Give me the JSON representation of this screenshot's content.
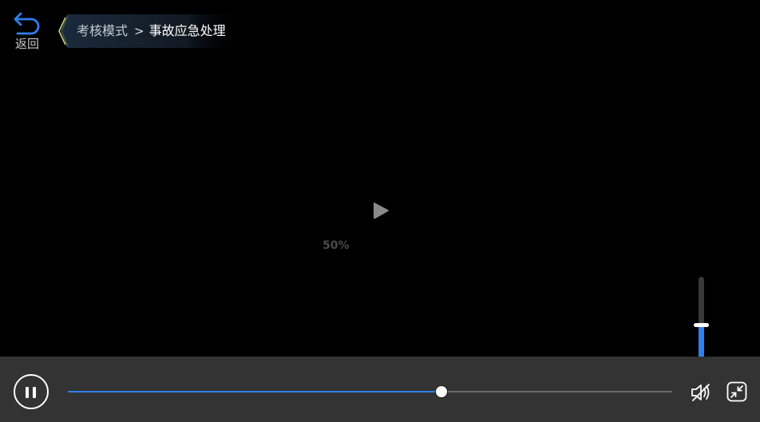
{
  "back": {
    "label": "返回",
    "icon": "undo-arrow-icon"
  },
  "breadcrumb": {
    "parent": "考核模式",
    "separator": ">",
    "current": "事故应急处理"
  },
  "video": {
    "loading_percent": "50%",
    "center_icon": "play-icon"
  },
  "player": {
    "progress": 0.618,
    "volume": 0.5,
    "buttons": {
      "pause_icon": "pause-icon",
      "mute_icon": "volume-muted-icon",
      "exit_fullscreen_icon": "exit-fullscreen-icon"
    }
  },
  "colors": {
    "accent": "#2f80ed",
    "control_bar": "#333333",
    "background": "#000000"
  }
}
